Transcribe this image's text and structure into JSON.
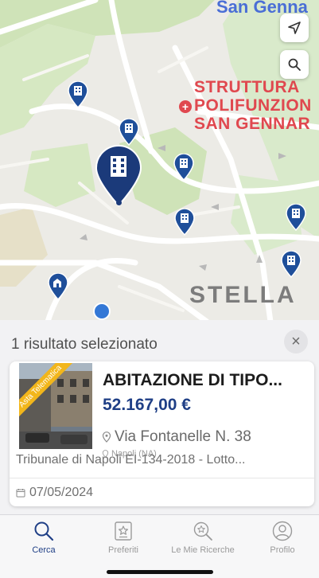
{
  "map": {
    "labels": {
      "area_top": "San Genna",
      "poi_line1": "STRUTTURA",
      "poi_line2": "POLIFUNZION",
      "poi_line3": "SAN GENNAR",
      "district": "STELLA"
    },
    "controls": {
      "locate_icon": "location-arrow-icon",
      "search_icon": "search-icon"
    }
  },
  "results": {
    "header": "1 risultato selezionato",
    "close_icon": "close-icon",
    "card": {
      "ribbon": "Asta Telematica",
      "title": "ABITAZIONE DI TIPO...",
      "price": "52.167,00 €",
      "address": "Via Fontanelle N. 38",
      "city": "Napoli (NA)",
      "court": "Tribunale di Napoli EI-134-2018 - Lotto...",
      "date": "07/05/2024"
    }
  },
  "tabbar": {
    "tabs": [
      {
        "label": "Cerca",
        "icon": "search-icon",
        "active": true
      },
      {
        "label": "Preferiti",
        "icon": "star-icon",
        "active": false
      },
      {
        "label": "Le Mie Ricerche",
        "icon": "saved-search-icon",
        "active": false
      },
      {
        "label": "Profilo",
        "icon": "profile-icon",
        "active": false
      }
    ]
  },
  "colors": {
    "accent": "#1f3f86",
    "pin": "#1f4f9a",
    "ribbon": "#f2b61b",
    "poi": "#e0484f"
  }
}
